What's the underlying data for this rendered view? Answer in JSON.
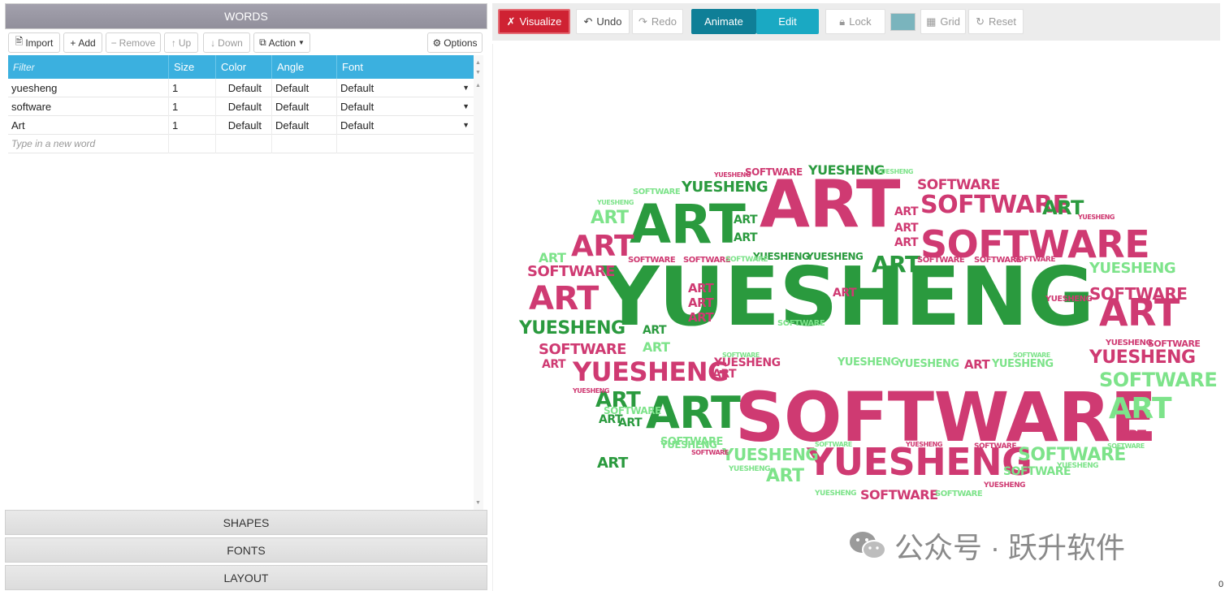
{
  "left_panel": {
    "words_header": "WORDS",
    "toolbar": {
      "import": "Import",
      "add": "Add",
      "remove": "Remove",
      "up": "Up",
      "down": "Down",
      "action": "Action",
      "options": "Options"
    },
    "table": {
      "filter_placeholder": "Filter",
      "columns": [
        "Size",
        "Color",
        "Angle",
        "Font"
      ],
      "rows": [
        {
          "word": "yuesheng",
          "size": "1",
          "color": "Default",
          "angle": "Default",
          "font": "Default"
        },
        {
          "word": "software",
          "size": "1",
          "color": "Default",
          "angle": "Default",
          "font": "Default"
        },
        {
          "word": "Art",
          "size": "1",
          "color": "Default",
          "angle": "Default",
          "font": "Default"
        }
      ],
      "new_word_placeholder": "Type in a new word"
    },
    "sections": {
      "shapes": "SHAPES",
      "fonts": "FONTS",
      "layout": "LAYOUT"
    }
  },
  "right_toolbar": {
    "visualize": "Visualize",
    "undo": "Undo",
    "redo": "Redo",
    "animate": "Animate",
    "edit": "Edit",
    "lock": "Lock",
    "grid": "Grid",
    "reset": "Reset",
    "swatch_color": "#7ab4bd"
  },
  "cloud": {
    "colors": {
      "dark_green": "#2a9a3e",
      "pink": "#cf3a72",
      "light_green": "#7de38a"
    },
    "words": {
      "yuesheng": "yuesheng",
      "software": "software",
      "art": "art"
    }
  },
  "watermark": {
    "text": "公众号 · 跃升软件"
  },
  "edge_digit": "0"
}
